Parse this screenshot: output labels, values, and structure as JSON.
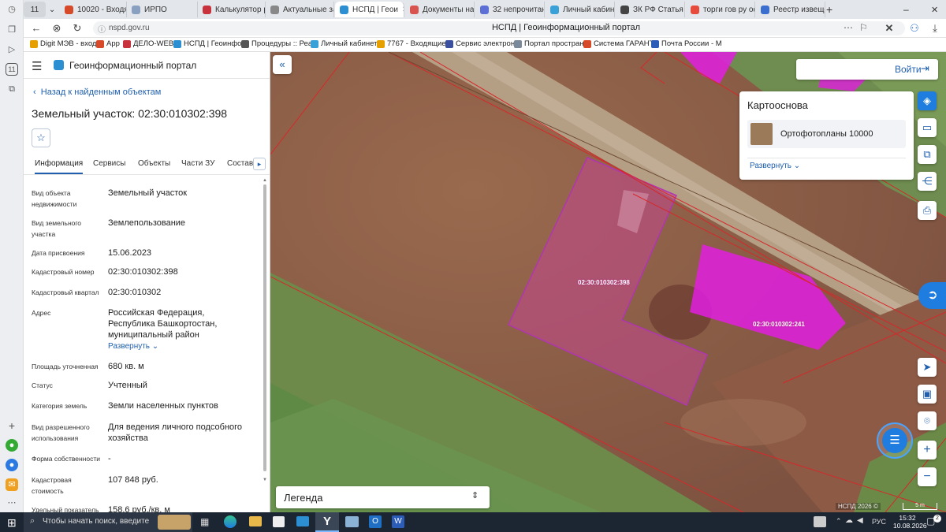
{
  "browser": {
    "tab_count": "11",
    "tabs": [
      {
        "label": "10020 - Входящ",
        "color": "#d64a2a"
      },
      {
        "label": "ИРПО",
        "color": "#8aa0c0"
      },
      {
        "label": "Калькулятор ра",
        "color": "#c8323c"
      },
      {
        "label": "Актуальные за",
        "color": "#888888"
      },
      {
        "label": "НСПД | Геои",
        "color": "#2c8fd1"
      },
      {
        "label": "Документы на",
        "color": "#d9534f"
      },
      {
        "label": "32 непрочитан",
        "color": "#5b6fd6"
      },
      {
        "label": "Личный кабине",
        "color": "#3aa0d8"
      },
      {
        "label": "ЗК РФ Статья 1",
        "color": "#444444"
      },
      {
        "label": "торги гов ру оф",
        "color": "#e64b3c"
      },
      {
        "label": "Реестр извеще",
        "color": "#3a6fcf"
      }
    ],
    "url": "nspd.gov.ru",
    "page_title": "НСПД | Геоинформационный портал",
    "bookmarks": [
      {
        "label": "Digit МЭВ - вход",
        "color": "#e5a000"
      },
      {
        "label": "App",
        "color": "#d64a2a"
      },
      {
        "label": "ДЕЛО-WEB",
        "color": "#c8323c"
      },
      {
        "label": "НСПД | Геоинфор",
        "color": "#2c8fd1"
      },
      {
        "label": "Процедуры :: Реа",
        "color": "#555555"
      },
      {
        "label": "Личный кабинет",
        "color": "#3aa0d8"
      },
      {
        "label": "7767 - Входящие",
        "color": "#e5a000"
      },
      {
        "label": "Сервис электрон",
        "color": "#3a4fa0"
      },
      {
        "label": "Портал простран",
        "color": "#7a8a9a"
      },
      {
        "label": "Система ГАРАНТ",
        "color": "#d64a2a"
      },
      {
        "label": "Почта России - М",
        "color": "#2b5cb8"
      }
    ]
  },
  "portal": {
    "name": "Геоинформационный портал",
    "back_link": "Назад к найденным объектам",
    "object_title": "Земельный участок: 02:30:010302:398",
    "tabs": [
      "Информация",
      "Сервисы",
      "Объекты",
      "Части ЗУ",
      "Состав"
    ],
    "fields": [
      {
        "label": "Вид объекта недвижимости",
        "value": "Земельный участок"
      },
      {
        "label": "Вид земельного участка",
        "value": "Землепользование"
      },
      {
        "label": "Дата присвоения",
        "value": "15.06.2023"
      },
      {
        "label": "Кадастровый номер",
        "value": "02:30:010302:398"
      },
      {
        "label": "Кадастровый квартал",
        "value": "02:30:010302"
      },
      {
        "label": "Адрес",
        "value": "Российская Федерация, Республика Башкортостан, муниципальный район Караидельский район,"
      },
      {
        "label": "Площадь уточненная",
        "value": "680 кв. м"
      },
      {
        "label": "Статус",
        "value": "Учтенный"
      },
      {
        "label": "Категория земель",
        "value": "Земли населенных пунктов"
      },
      {
        "label": "Вид разрешенного использования",
        "value": "Для ведения личного подсобного хозяйства"
      },
      {
        "label": "Форма собственности",
        "value": "-"
      },
      {
        "label": "Кадастровая стоимость",
        "value": "107 848 руб."
      },
      {
        "label": "Удельный показатель",
        "value": "158,6 руб./кв. м"
      }
    ],
    "expand_label": "Развернуть"
  },
  "map": {
    "login_label": "Войти",
    "basemap_title": "Картооснова",
    "basemap_item": "Ортофотопланы 10000",
    "basemap_expand": "Развернуть",
    "legend_label": "Легенда",
    "parcel_label_1": "02:30:010302:398",
    "parcel_label_2": "02:30:010302:241",
    "copyright": "НСПД 2026 ©",
    "scale_label": "5 m",
    "colors": {
      "parcel_fill": "#c04a8a",
      "highlight": "#e21ee0",
      "boundary": "#d6282a",
      "accent": "#1f5fad"
    }
  },
  "taskbar": {
    "search_placeholder": "Чтобы начать поиск, введите",
    "lang": "РУС",
    "time": "15:32",
    "date": "10.08.2026",
    "notifications": "2"
  }
}
